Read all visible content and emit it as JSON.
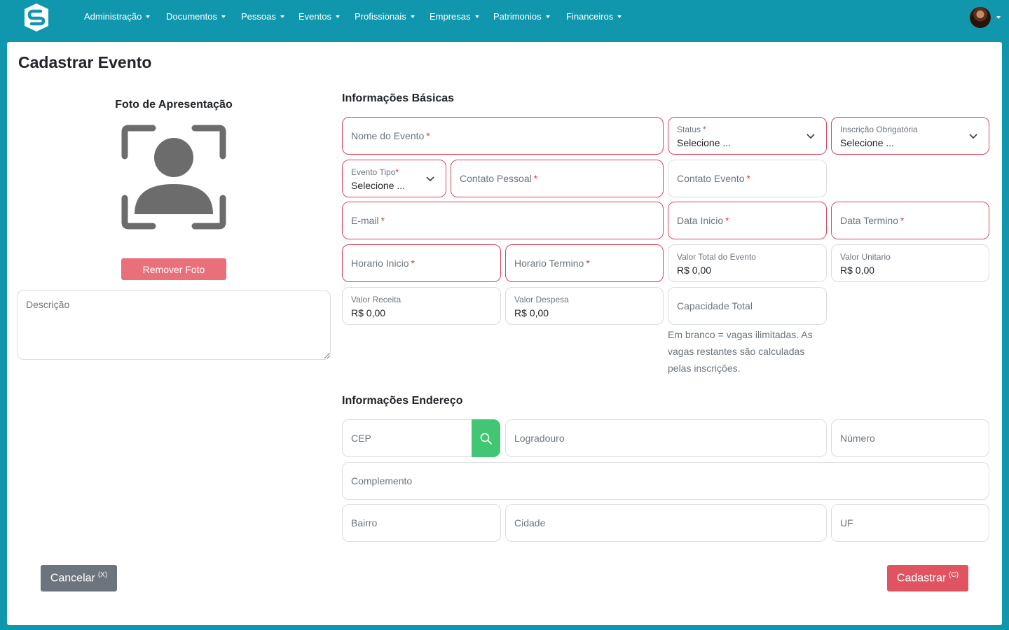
{
  "nav": {
    "items": [
      "Administração",
      "Documentos",
      "Pessoas",
      "Eventos",
      "Profissionais",
      "Empresas",
      "Patrimonios",
      "Financeiros"
    ]
  },
  "page": {
    "title": "Cadastrar Evento"
  },
  "photo": {
    "title": "Foto de Apresentação",
    "remove_label": "Remover Foto"
  },
  "description": {
    "placeholder": "Descrição"
  },
  "sections": {
    "basic": "Informações Básicas",
    "address": "Informações Endereço"
  },
  "fields": {
    "nome_evento": "Nome do Evento",
    "status_label": "Status",
    "status_value": "Selecione ...",
    "inscricao_label": "Inscrição Obrigatória",
    "inscricao_value": "Selecione ...",
    "evento_tipo_label": "Evento Tipo",
    "evento_tipo_value": "Selecione ...",
    "contato_pessoal": "Contato Pessoal",
    "contato_evento": "Contato Evento",
    "email": "E-mail",
    "data_inicio": "Data Inicio",
    "data_termino": "Data Termino",
    "horario_inicio": "Horario Inicio",
    "horario_termino": "Horario Termino",
    "valor_total_label": "Valor Total do Evento",
    "valor_total_value": "R$ 0,00",
    "valor_unitario_label": "Valor Unitario",
    "valor_unitario_value": "R$ 0,00",
    "valor_receita_label": "Valor Receita",
    "valor_receita_value": "R$ 0,00",
    "valor_despesa_label": "Valor Despesa",
    "valor_despesa_value": "R$ 0,00",
    "capacidade_total": "Capacidade Total",
    "capacidade_help": "Em branco = vagas ilimitadas. As vagas restantes são calculadas pelas inscrições."
  },
  "address": {
    "cep": "CEP",
    "logradouro": "Logradouro",
    "numero": "Número",
    "complemento": "Complemento",
    "bairro": "Bairro",
    "cidade": "Cidade",
    "uf": "UF"
  },
  "required_mark": "*",
  "actions": {
    "cancel_label": "Cancelar",
    "cancel_shortcut": "(X)",
    "submit_label": "Cadastrar",
    "submit_shortcut": "(C)"
  },
  "colors": {
    "brand": "#1197ad",
    "danger": "#dc3545",
    "success": "#42c674",
    "secondary": "#6c757d"
  }
}
